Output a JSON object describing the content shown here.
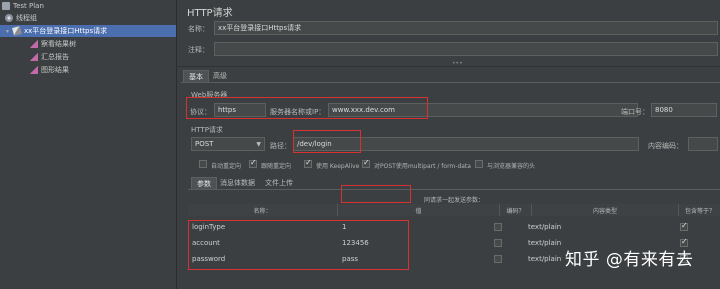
{
  "tree": {
    "items": [
      {
        "label": "Test Plan",
        "icon": "test-plan-icon"
      },
      {
        "label": "线程组",
        "icon": "thread-group-icon"
      },
      {
        "label": "xx平台登录接口Https请求",
        "icon": "http-sampler-icon"
      },
      {
        "label": "察看结果树",
        "icon": "listener-icon"
      },
      {
        "label": "汇总报告",
        "icon": "listener-icon"
      },
      {
        "label": "图形结果",
        "icon": "listener-icon"
      }
    ]
  },
  "panel": {
    "title": "HTTP请求",
    "name_label": "名称：",
    "name_value": "xx平台登录接口Https请求",
    "comment_label": "注释：",
    "tabs": [
      "基本",
      "高级"
    ],
    "web_server_section": "Web服务器",
    "protocol_label": "协议：",
    "protocol_value": "https",
    "server_label": "服务器名称或IP：",
    "server_value": "www.xxx.dev.com",
    "port_label": "端口号：",
    "port_value": "8080",
    "http_request_section": "HTTP请求",
    "method_value": "POST",
    "path_label": "路径：",
    "path_value": "/dev/login",
    "encoding_label": "内容编码：",
    "options": [
      {
        "label": "自动重定向",
        "checked": false
      },
      {
        "label": "跟随重定向",
        "checked": true
      },
      {
        "label": "使用 KeepAlive",
        "checked": true
      },
      {
        "label": "对POST使用multipart / form-data",
        "checked": true
      },
      {
        "label": "与浏览器兼容的头",
        "checked": false
      }
    ],
    "param_tabs": [
      "参数",
      "消息体数据",
      "文件上传"
    ],
    "table_caption": "同请求一起发送参数：",
    "columns": [
      "名称：",
      "值",
      "编码？",
      "内容类型",
      "包含等于？"
    ],
    "rows": [
      {
        "name": "loginType",
        "value": "1",
        "encode": false,
        "content_type": "text/plain",
        "include_equals": true
      },
      {
        "name": "account",
        "value": "123456",
        "encode": false,
        "content_type": "text/plain",
        "include_equals": true
      },
      {
        "name": "password",
        "value": "pass",
        "encode": false,
        "content_type": "text/plain",
        "include_equals": true
      }
    ]
  },
  "watermark": "知乎 @有来有去",
  "colors": {
    "selection": "#4b6eaf",
    "highlight_box": "#d63232",
    "background": "#3c3f41"
  }
}
